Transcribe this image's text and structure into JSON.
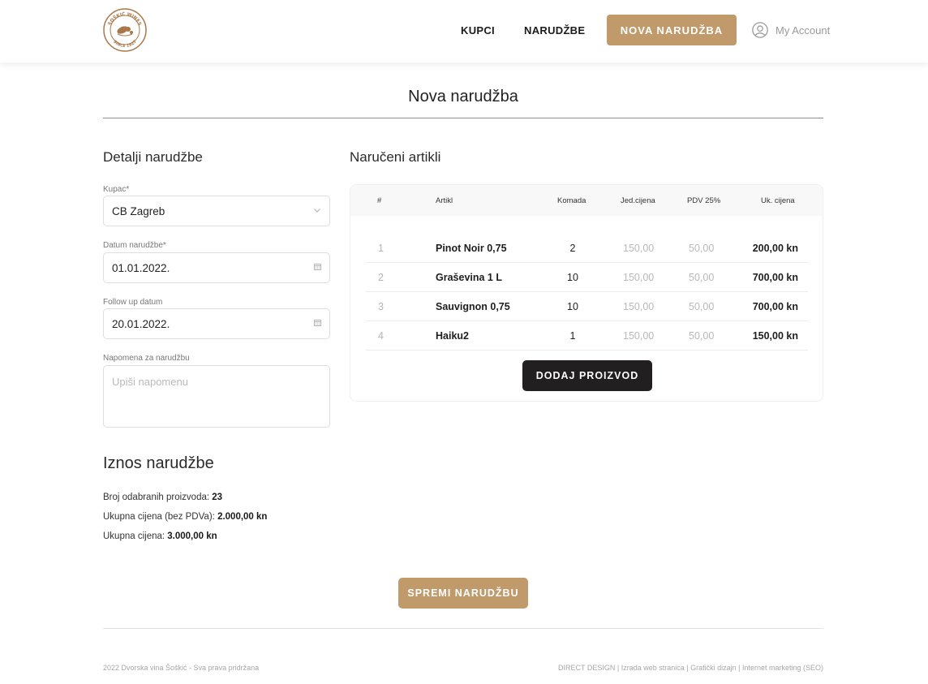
{
  "header": {
    "logo": {
      "icon": "winery-seal-logo",
      "ring_top": "ŠOŠKIĆ WINES",
      "ring_bottom": "SINCE 1927"
    },
    "nav": [
      {
        "label": "KUPCI"
      },
      {
        "label": "NARUDŽBE"
      }
    ],
    "cta_label": "NOVA NARUDŽBA",
    "account_label": "My Account",
    "account_icon": "user-circle-icon"
  },
  "page_title": "Nova narudžba",
  "details": {
    "heading": "Detalji narudžbe",
    "customer": {
      "label": "Kupac*",
      "value": "CB Zagreb",
      "icon": "chevron-down-icon"
    },
    "order_date": {
      "label": "Datum narudžbe*",
      "value": "01.01.2022.",
      "icon": "calendar-icon"
    },
    "follow_up": {
      "label": "Follow up datum",
      "value": "20.01.2022.",
      "icon": "calendar-icon"
    },
    "note": {
      "label": "Napomena za narudžbu",
      "placeholder": "Upiši napomenu"
    }
  },
  "summary": {
    "heading": "Iznos narudžbe",
    "count_label": "Broj odabranih proizvoda: ",
    "count_value": "23",
    "net_label": "Ukupna cijena (bez PDVa): ",
    "net_value": "2.000,00 kn",
    "total_label": "Ukupna cijena: ",
    "total_value": "3.000,00 kn"
  },
  "items": {
    "heading": "Naručeni artikli",
    "columns": [
      "#",
      "Artikl",
      "Komada",
      "Jed.cijena",
      "PDV 25%",
      "Uk. cijena"
    ],
    "rows": [
      {
        "num": "1",
        "name": "Pinot Noir 0,75",
        "qty": "2",
        "unit": "150,00",
        "vat": "50,00",
        "total": "200,00 kn"
      },
      {
        "num": "2",
        "name": "Graševina 1 L",
        "qty": "10",
        "unit": "150,00",
        "vat": "50,00",
        "total": "700,00 kn"
      },
      {
        "num": "3",
        "name": "Sauvignon 0,75",
        "qty": "10",
        "unit": "150,00",
        "vat": "50,00",
        "total": "700,00 kn"
      },
      {
        "num": "4",
        "name": "Haiku2",
        "qty": "1",
        "unit": "150,00",
        "vat": "50,00",
        "total": "150,00 kn"
      }
    ],
    "add_label": "DODAJ PROIZVOD"
  },
  "save_label": "SPREMI NARUDŽBU",
  "footer": {
    "left": "2022 Dvorska vina Šoškić  - Sva prava pridržana",
    "links": [
      "DIRECT DESIGN",
      "Izrada web stranica",
      "Grafički dizajn",
      "Internet marketing (SEO)"
    ],
    "separator": " | "
  },
  "colors": {
    "accent": "#c19a6b",
    "dark_button": "#211f1f"
  }
}
